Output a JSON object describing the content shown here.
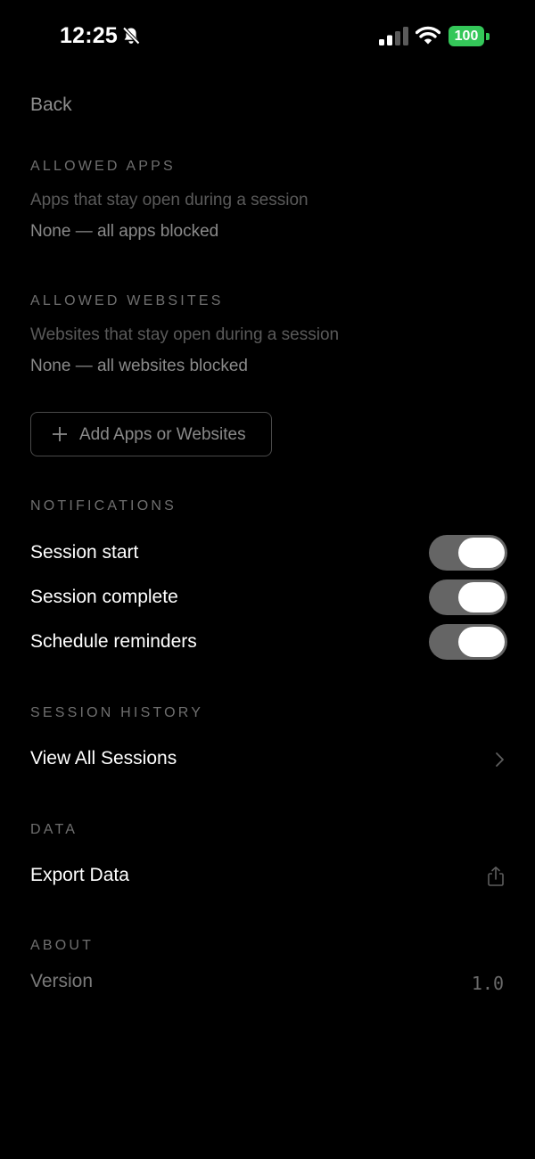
{
  "status_bar": {
    "time": "12:25",
    "battery": "100",
    "battery_color": "#34c759",
    "icons": [
      "bell-slash-icon",
      "cellular-signal-icon",
      "wifi-icon",
      "battery-icon"
    ]
  },
  "nav": {
    "back_label": "Back"
  },
  "allowed_apps": {
    "header": "ALLOWED APPS",
    "description": "Apps that stay open during a session",
    "status": "None — all apps blocked"
  },
  "allowed_websites": {
    "header": "ALLOWED WEBSITES",
    "description": "Websites that stay open during a session",
    "status": "None — all websites blocked"
  },
  "add_button": {
    "icon": "plus-icon",
    "label": "Add Apps or Websites"
  },
  "notifications": {
    "header": "NOTIFICATIONS",
    "items": [
      {
        "label": "Session start",
        "enabled": true
      },
      {
        "label": "Session complete",
        "enabled": true
      },
      {
        "label": "Schedule reminders",
        "enabled": true
      }
    ]
  },
  "session_history": {
    "header": "SESSION HISTORY",
    "view_all_label": "View All Sessions",
    "icon": "chevron-right-icon"
  },
  "data_section": {
    "header": "DATA",
    "export_label": "Export Data",
    "icon": "share-icon"
  },
  "about": {
    "header": "ABOUT",
    "version_label": "Version",
    "version_value": "1.0"
  },
  "colors": {
    "background": "#000000",
    "toggle_track": "#656565",
    "toggle_knob": "#ffffff",
    "header_text": "#6f6f6f"
  }
}
